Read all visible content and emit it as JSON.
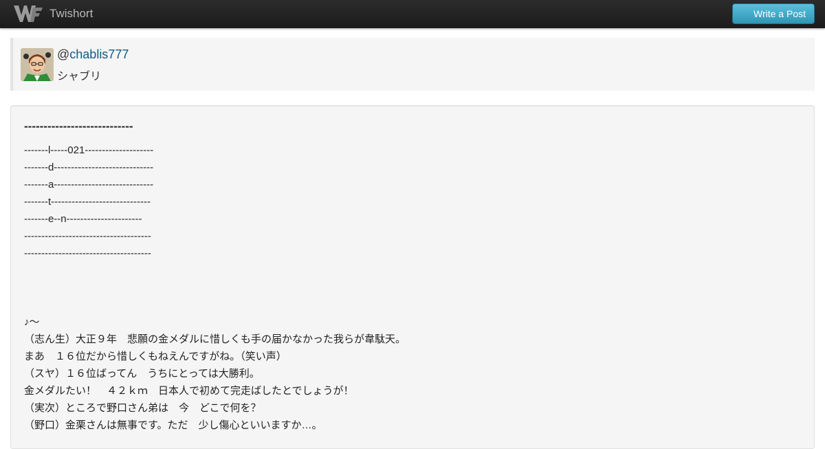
{
  "navbar": {
    "brand_name": "Twishort",
    "write_button_label": "Write a Post"
  },
  "user": {
    "at_sign": "@",
    "handle": "chablis777",
    "display_name": "シャブリ"
  },
  "post": {
    "heading": "----------------------------",
    "lines": [
      "-------l-----021--------------------",
      "-------d-----------------------------",
      "-------a-----------------------------",
      "-------t-----------------------------",
      "-------e--n----------------------",
      "-------------------------------------",
      "-------------------------------------",
      "",
      "",
      "",
      "♪～",
      "（志ん生）大正９年　悲願の金メダルに惜しくも手の届かなかった我らが韋駄天。",
      "まあ　１６位だから惜しくもねえんですがね。（笑い声）",
      "（スヤ）１６位ばってん　うちにとっては大勝利。",
      "金メダルたい！　４２ｋｍ　日本人で初めて完走ばしたとでしょうが！",
      "（実次）ところで野口さん弟は　今　どこで何を？",
      "（野口）金栗さんは無事です。ただ　少し傷心といいますか…。"
    ]
  },
  "colors": {
    "navbar": "#1b1b1b",
    "button": "#2f96b4",
    "link": "#0e5a86",
    "card_bg": "#f5f5f5"
  }
}
